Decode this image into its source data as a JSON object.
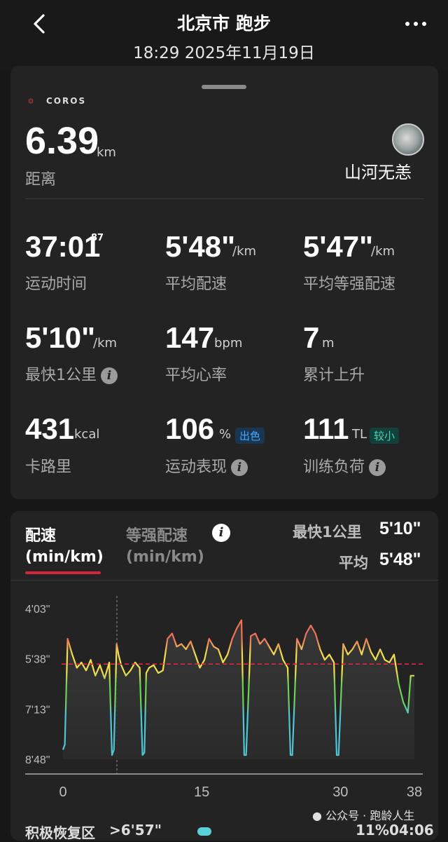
{
  "header": {
    "title": "北京市 跑步",
    "datetime": "18:29 2025年11月19日"
  },
  "brand": {
    "logo_text": "COROS"
  },
  "distance": {
    "value": "6.39",
    "unit": "km",
    "label": "距离"
  },
  "user": {
    "name": "山河无恙"
  },
  "stats": {
    "time": {
      "value": "37:01",
      "sub": "87",
      "label": "运动时间"
    },
    "avg_pace": {
      "value": "5'48\"",
      "unit": "/km",
      "label": "平均配速"
    },
    "avg_gap": {
      "value": "5'47\"",
      "unit": "/km",
      "label": "平均等强配速"
    },
    "fastest_km": {
      "value": "5'10\"",
      "unit": "/km",
      "label": "最快1公里"
    },
    "avg_hr": {
      "value": "147",
      "unit": "bpm",
      "label": "平均心率"
    },
    "elev": {
      "value": "7",
      "unit": "m",
      "label": "累计上升"
    },
    "calories": {
      "value": "431",
      "unit": "kcal",
      "label": "卡路里"
    },
    "performance": {
      "value": "106",
      "unit": "%",
      "badge": "出色",
      "label": "运动表现"
    },
    "training_load": {
      "value": "111",
      "unit": "TL",
      "badge": "较小",
      "label": "训练负荷"
    }
  },
  "pace_panel": {
    "tab_active_line1": "配速",
    "tab_active_line2": "(min/km)",
    "tab_inactive_line1": "等强配速",
    "tab_inactive_line2": "(min/km)",
    "fastest_label": "最快1公里",
    "fastest_value": "5'10\"",
    "avg_label": "平均",
    "avg_value": "5'48\""
  },
  "chart_data": {
    "type": "area",
    "title": "",
    "xlabel": "",
    "ylabel": "",
    "y_ticks": [
      "4'03\"",
      "5'38\"",
      "7'13\"",
      "8'48\""
    ],
    "x_ticks": [
      "0",
      "15",
      "30",
      "38"
    ],
    "xlim": [
      0,
      38
    ],
    "ylim_seconds": [
      243,
      528
    ],
    "average_line_seconds": 348,
    "colors": {
      "fast": "#f0705a",
      "medium": "#f2df4d",
      "slow": "#6fcf5a",
      "very_slow": "#4fc6d6",
      "avg_line": "#e0293a"
    },
    "x": [
      0,
      0.2,
      0.5,
      1,
      1.5,
      2,
      2.5,
      3,
      3.5,
      4,
      4.5,
      5,
      5.3,
      5.5,
      5.8,
      6,
      6.3,
      6.8,
      7.3,
      7.8,
      8.3,
      8.6,
      8.8,
      9,
      9.3,
      9.8,
      10.3,
      10.8,
      11.3,
      11.8,
      12.3,
      12.8,
      13.3,
      13.8,
      14.3,
      14.8,
      15.3,
      15.8,
      16.3,
      16.8,
      17.3,
      17.8,
      18.3,
      18.8,
      19.3,
      19.6,
      19.8,
      20.3,
      20.8,
      21.3,
      21.8,
      22.3,
      22.8,
      23.3,
      23.8,
      24.3,
      24.6,
      24.8,
      25.3,
      25.8,
      26.3,
      26.8,
      27.3,
      27.8,
      28.3,
      28.8,
      29.3,
      29.6,
      29.8,
      30.3,
      30.8,
      31.3,
      31.8,
      32.3,
      32.8,
      33.3,
      33.8,
      34.3,
      34.8,
      35.3,
      35.8,
      36.3,
      36.8,
      37.3,
      37.6,
      38
    ],
    "y_seconds": [
      510,
      500,
      300,
      330,
      355,
      345,
      360,
      340,
      370,
      350,
      375,
      345,
      520,
      510,
      310,
      330,
      350,
      370,
      360,
      345,
      355,
      520,
      515,
      365,
      355,
      350,
      365,
      360,
      300,
      290,
      315,
      310,
      320,
      305,
      330,
      355,
      340,
      300,
      315,
      320,
      345,
      330,
      300,
      280,
      265,
      520,
      520,
      295,
      290,
      310,
      300,
      315,
      330,
      310,
      340,
      355,
      520,
      520,
      300,
      320,
      290,
      275,
      290,
      320,
      340,
      330,
      345,
      520,
      520,
      310,
      330,
      320,
      305,
      330,
      300,
      325,
      340,
      320,
      340,
      345,
      330,
      385,
      420,
      440,
      370,
      370
    ]
  },
  "footer": {
    "zone_label": "积极恢复区",
    "zone_pace": ">6'57\"",
    "percent": "11%",
    "time": "04:06"
  },
  "watermark": {
    "text": "公众号 · 跑龄人生"
  }
}
